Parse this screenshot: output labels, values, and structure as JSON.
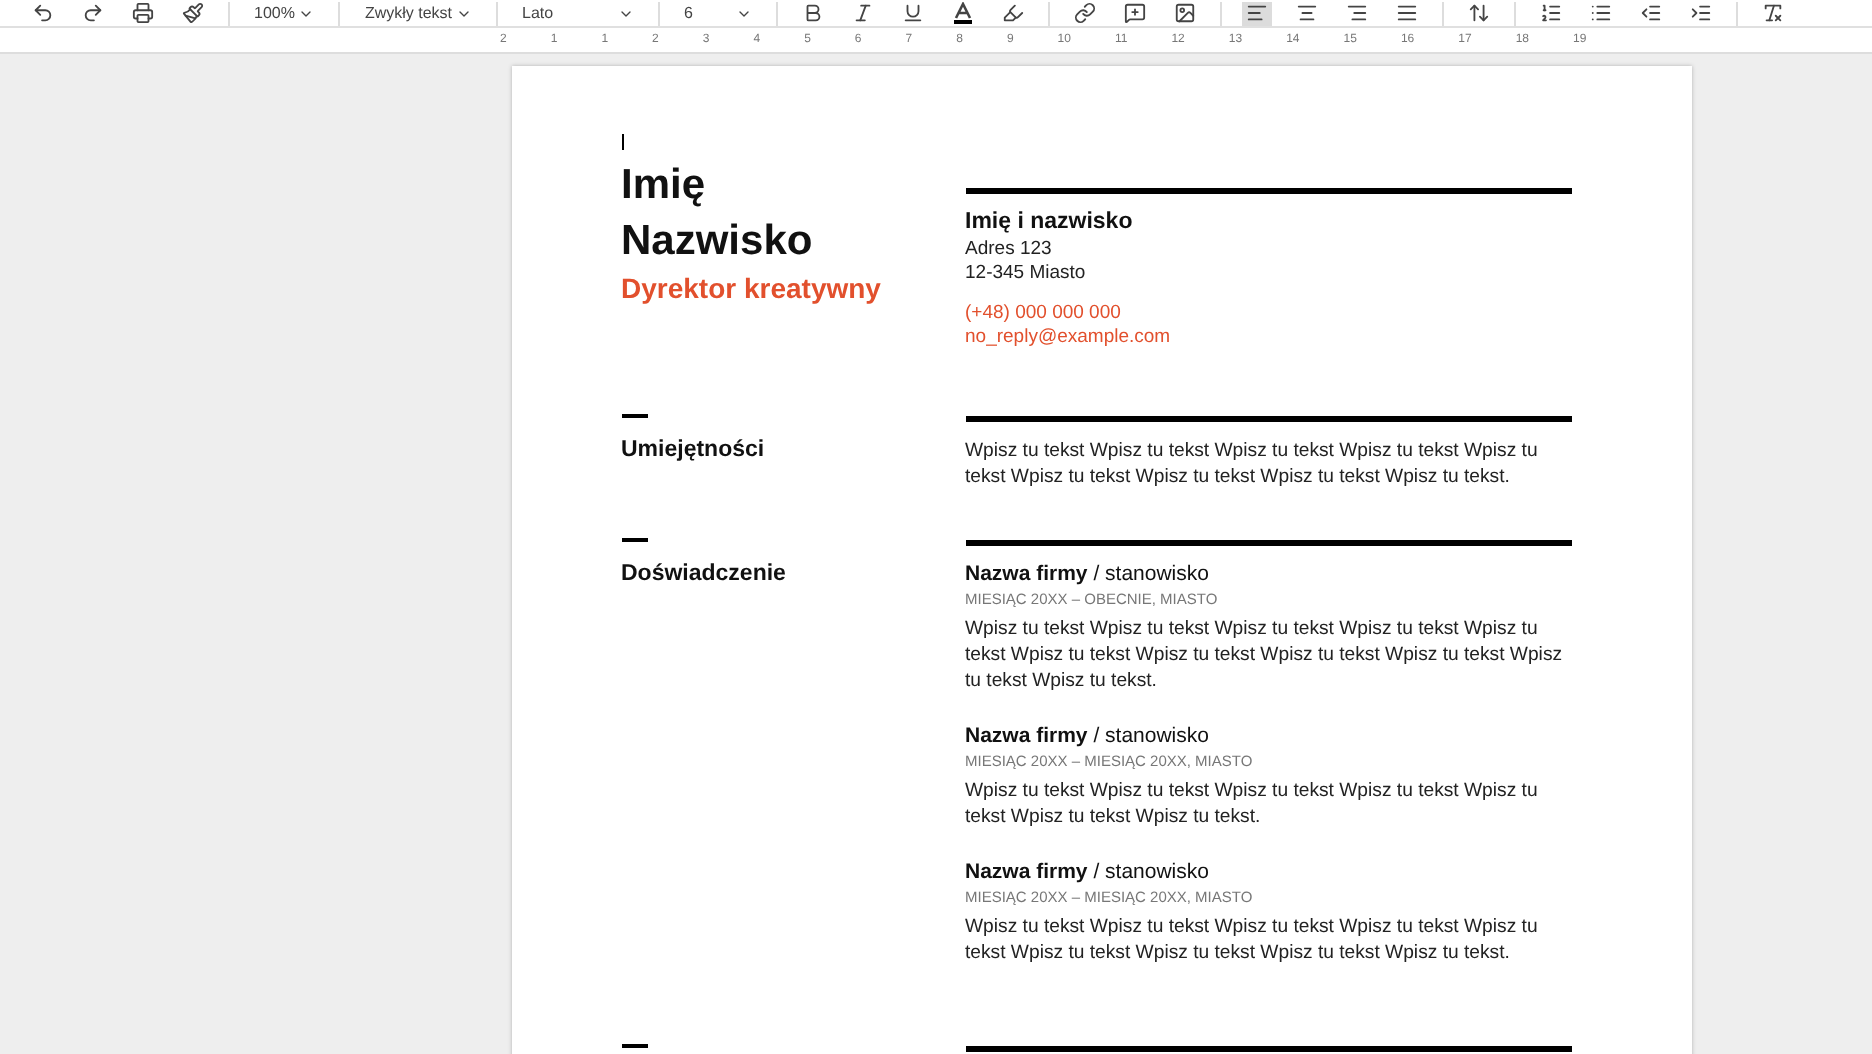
{
  "toolbar": {
    "zoom": "100%",
    "style": "Zwykły tekst",
    "font": "Lato",
    "size": "6",
    "align_buttons": [
      {
        "kind": "left",
        "selected": true
      },
      {
        "kind": "center",
        "selected": false
      },
      {
        "kind": "right",
        "selected": false
      },
      {
        "kind": "justify",
        "selected": false
      }
    ]
  },
  "ruler": {
    "labels": [
      "2",
      "1",
      "1",
      "2",
      "3",
      "4",
      "5",
      "6",
      "7",
      "8",
      "9",
      "10",
      "11",
      "12",
      "13",
      "14",
      "15",
      "16",
      "17",
      "18",
      "19"
    ]
  },
  "resume": {
    "name_lines": [
      "Imię",
      "Nazwisko"
    ],
    "title": "Dyrektor kreatywny",
    "contact": {
      "name": "Imię i nazwisko",
      "address": [
        "Adres 123",
        "12-345 Miasto"
      ],
      "phone": "(+48) 000 000 000",
      "email": "no_reply@example.com"
    },
    "sections": [
      {
        "kind": "text",
        "heading": "Umiejętności",
        "text": "Wpisz tu tekst Wpisz tu tekst Wpisz tu tekst Wpisz tu tekst Wpisz tu tekst Wpisz tu tekst Wpisz tu tekst Wpisz tu tekst Wpisz tu tekst."
      },
      {
        "kind": "jobs",
        "heading": "Doświadczenie",
        "jobs": [
          {
            "title": "**Nazwa firmy** / stanowisko",
            "dates": "MIESIĄC 20XX – OBECNIE, MIASTO",
            "text": "Wpisz tu tekst Wpisz tu tekst Wpisz tu tekst Wpisz tu tekst Wpisz tu tekst Wpisz tu tekst Wpisz tu tekst Wpisz tu tekst Wpisz tu tekst Wpisz tu tekst Wpisz tu tekst."
          },
          {
            "title": "**Nazwa firmy** / stanowisko",
            "dates": "MIESIĄC 20XX – MIESIĄC 20XX, MIASTO",
            "text": "Wpisz tu tekst Wpisz tu tekst Wpisz tu tekst Wpisz tu tekst Wpisz tu tekst Wpisz tu tekst Wpisz tu tekst."
          },
          {
            "title": "**Nazwa firmy** / stanowisko",
            "dates": "MIESIĄC 20XX – MIESIĄC 20XX, MIASTO",
            "text": "Wpisz tu tekst Wpisz tu tekst Wpisz tu tekst Wpisz tu tekst Wpisz tu tekst Wpisz tu tekst Wpisz tu tekst Wpisz tu tekst Wpisz tu tekst."
          }
        ]
      },
      {
        "kind": "blank"
      }
    ]
  }
}
